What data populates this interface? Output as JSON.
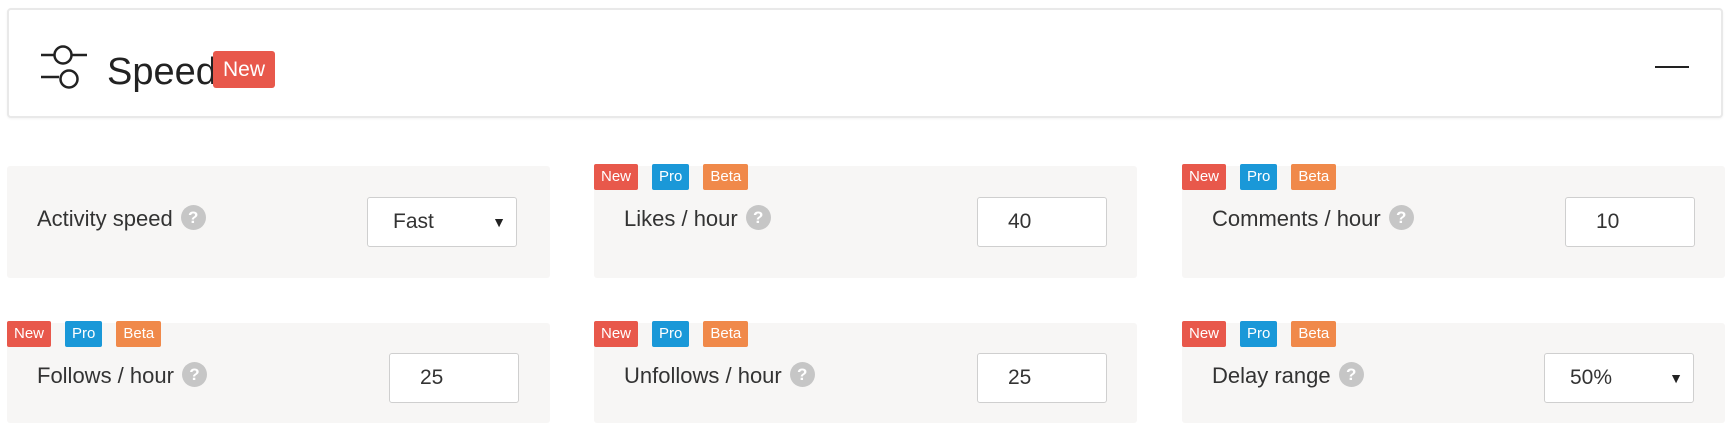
{
  "header": {
    "title": "Speed",
    "badge": "New",
    "icon": "sliders-icon",
    "collapse_icon": "minus-icon"
  },
  "colors": {
    "new": "#e8584b",
    "pro": "#1a98d8",
    "beta": "#f0894a",
    "card_bg": "#f7f6f5",
    "help": "#c6c6c6"
  },
  "badges": {
    "new": "New",
    "pro": "Pro",
    "beta": "Beta"
  },
  "settings": {
    "activity_speed": {
      "label": "Activity speed",
      "value": "Fast"
    },
    "likes_per_hour": {
      "label": "Likes / hour",
      "value": "40"
    },
    "comments_per_hour": {
      "label": "Comments / hour",
      "value": "10"
    },
    "follows_per_hour": {
      "label": "Follows / hour",
      "value": "25"
    },
    "unfollows_per_hour": {
      "label": "Unfollows / hour",
      "value": "25"
    },
    "delay_range": {
      "label": "Delay range",
      "value": "50%"
    }
  },
  "help_glyph": "?",
  "select_arrow": "▼"
}
